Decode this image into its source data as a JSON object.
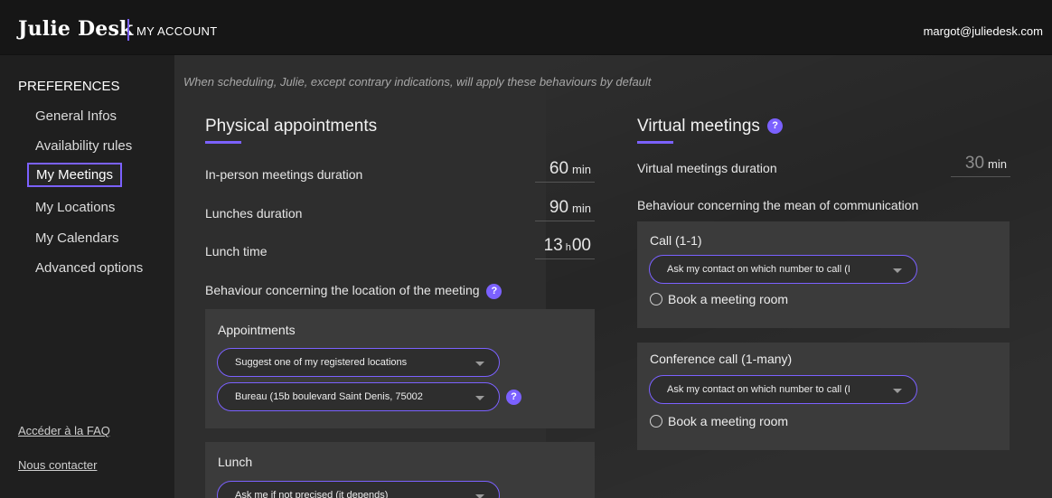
{
  "header": {
    "brand": "Julie Desk",
    "section": "MY ACCOUNT",
    "email": "margot@juliedesk.com"
  },
  "sidebar": {
    "heading": "PREFERENCES",
    "items": [
      {
        "label": "General Infos"
      },
      {
        "label": "Availability rules"
      },
      {
        "label": "My Meetings"
      },
      {
        "label": "My Locations"
      },
      {
        "label": "My Calendars"
      },
      {
        "label": "Advanced options"
      }
    ],
    "active_item": "My Meetings",
    "faq_link": "Accéder à la FAQ",
    "contact_link": "Nous contacter"
  },
  "main": {
    "intro": "When scheduling, Julie, except contrary indications, will apply these behaviours by default",
    "physical": {
      "title": "Physical appointments",
      "inperson_label": "In-person meetings duration",
      "inperson_value": "60",
      "inperson_unit": "min",
      "lunch_label": "Lunches duration",
      "lunch_value": "90",
      "lunch_unit": "min",
      "lunchtime_label": "Lunch time",
      "lunchtime_hour": "13",
      "lunchtime_sep": "h",
      "lunchtime_min": "00",
      "location_label": "Behaviour concerning the location of the meeting",
      "appointments": {
        "title": "Appointments",
        "select1": "Suggest one of my registered locations",
        "select2": "Bureau (15b boulevard Saint Denis, 75002"
      },
      "lunch": {
        "title": "Lunch",
        "select1": "Ask me if not precised (it depends)"
      }
    },
    "virtual": {
      "title": "Virtual meetings",
      "duration_label": "Virtual meetings duration",
      "duration_value": "30",
      "duration_unit": "min",
      "comm_label": "Behaviour concerning the mean of communication",
      "call": {
        "title": "Call (1-1)",
        "select": "Ask my contact on which number to call (I",
        "radio": "Book a meeting room"
      },
      "conference": {
        "title": "Conference call (1-many)",
        "select": "Ask my contact on which number to call (I",
        "radio": "Book a meeting room"
      }
    },
    "help_glyph": "?"
  },
  "colors": {
    "accent": "#7b61ff",
    "topbar": "#161616",
    "sidebar": "#1f1f1f",
    "main": "#2e2e2e",
    "panel": "#3b3b3b"
  }
}
